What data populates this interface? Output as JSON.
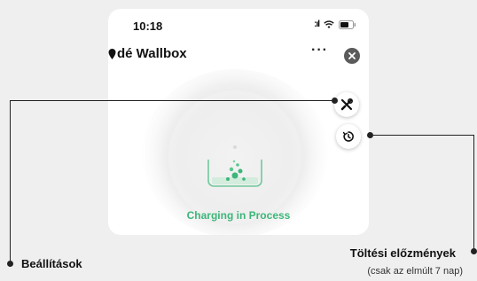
{
  "status_bar": {
    "time": "10:18",
    "signal": ":ıl"
  },
  "header": {
    "title": "dé Wallbox",
    "more_label": "···"
  },
  "main": {
    "status": "Charging in Process"
  },
  "callouts": {
    "settings": "Beállítások",
    "history": "Töltési előzmények",
    "history_note": "(csak az elmúlt 7 nap)"
  },
  "colors": {
    "accent_green": "#3cb679",
    "close_button": "#5b5b5b"
  },
  "icons": [
    "pin-icon",
    "wifi-icon",
    "battery-icon",
    "more-icon",
    "close-icon",
    "tools-icon",
    "history-icon",
    "charging-icon"
  ]
}
